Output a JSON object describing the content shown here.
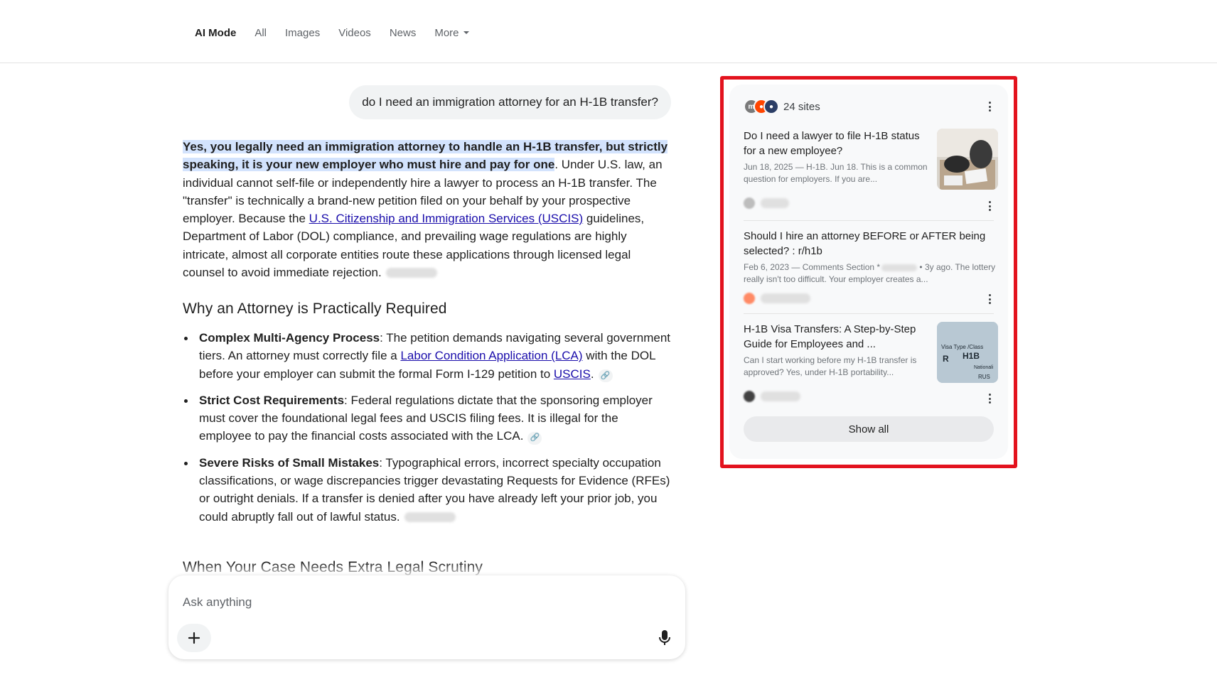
{
  "nav": {
    "tabs": [
      {
        "label": "AI Mode"
      },
      {
        "label": "All"
      },
      {
        "label": "Images"
      },
      {
        "label": "Videos"
      },
      {
        "label": "News"
      },
      {
        "label": "More"
      }
    ]
  },
  "query": "do I need an immigration attorney for an H-1B transfer?",
  "answer": {
    "highlight": "Yes, you legally need an immigration attorney to handle an H-1B transfer, but strictly speaking, it is your new employer who must hire and pay for one",
    "body_1": ". Under U.S. law, an individual cannot self-file or independently hire a lawyer to process an H-1B transfer. The \"transfer\" is technically a brand-new petition filed on your behalf by your prospective employer. Because the ",
    "uscis_link": "U.S. Citizenship and Immigration Services (USCIS)",
    "body_2": " guidelines, Department of Labor (DOL) compliance, and prevailing wage regulations are highly intricate, almost all corporate entities route these applications through licensed legal counsel to avoid immediate rejection."
  },
  "section_1_heading": "Why an Attorney is Practically Required",
  "bullets": [
    {
      "bold": "Complex Multi-Agency Process",
      "text_a": ": The petition demands navigating several government tiers. An attorney must correctly file a ",
      "link_a": "Labor Condition Application (LCA)",
      "text_b": " with the DOL before your employer can submit the formal Form I-129 petition to ",
      "link_b": "USCIS",
      "text_c": "."
    },
    {
      "bold": "Strict Cost Requirements",
      "text": ": Federal regulations dictate that the sponsoring employer must cover the foundational legal fees and USCIS filing fees. It is illegal for the employee to pay the financial costs associated with the LCA."
    },
    {
      "bold": "Severe Risks of Small Mistakes",
      "text": ": Typographical errors, incorrect specialty occupation classifications, or wage discrepancies trigger devastating Requests for Evidence (RFEs) or outright denials. If a transfer is denied after you have already left your prior job, you could abruptly fall out of lawful status."
    }
  ],
  "section_2_heading": "When Your Case Needs Extra Legal Scrutiny",
  "ask": {
    "placeholder": "Ask anything"
  },
  "sources": {
    "count_label": "24 sites",
    "items": [
      {
        "title": "Do I need a lawyer to file H-1B status for a new employee?",
        "snippet": "Jun 18, 2025 — H-1B. Jun 18. This is a common question for employers. If you are...",
        "has_thumb": true,
        "thumb_icon": "people-meeting-photo"
      },
      {
        "title": "Should I hire an attorney BEFORE or AFTER being selected? : r/h1b",
        "snippet_a": "Feb 6, 2023 — Comments Section *",
        "snippet_b": " • 3y ago. The lottery really isn't too difficult. Your employer creates a...",
        "has_thumb": false
      },
      {
        "title": "H-1B Visa Transfers: A Step-by-Step Guide for Employees and ...",
        "snippet": "Can I start working before my H-1B transfer is approved? Yes, under H-1B portability...",
        "has_thumb": true,
        "thumb_text": "Visa Type /Class  R  H1B  Nationali  RUS"
      }
    ],
    "show_all": "Show all"
  },
  "colors": {
    "highlight": "#d3e3fd",
    "link": "#1a0dab",
    "outline": "#e3131e",
    "card_bg": "#f8f9fa"
  }
}
